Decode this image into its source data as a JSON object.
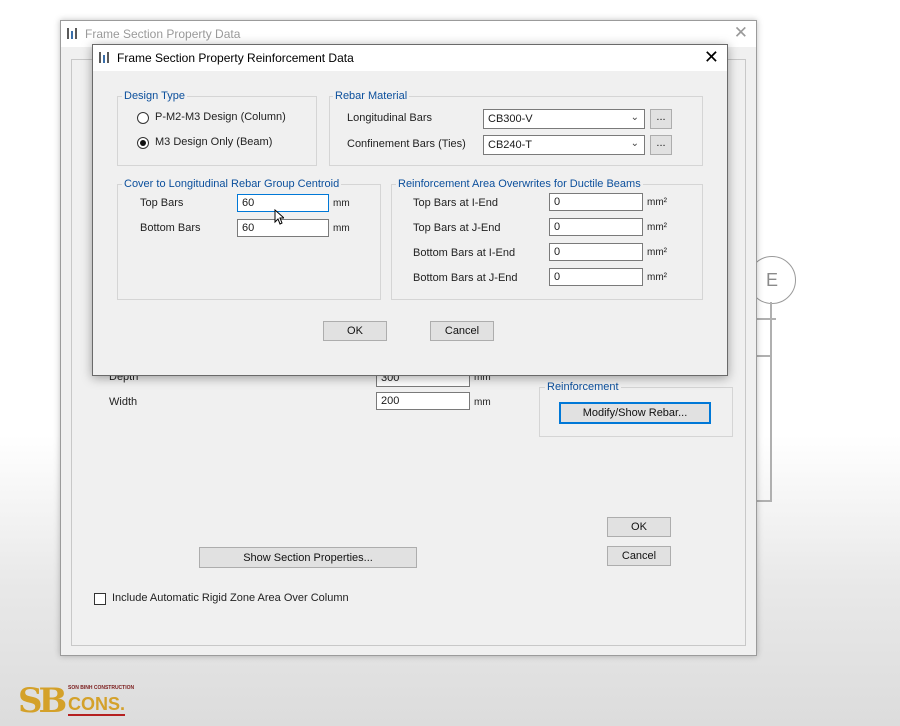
{
  "outer_window": {
    "title": "Frame Section Property Data",
    "close_glyph": "✕",
    "depth_label": "Depth",
    "depth_value": "300",
    "depth_unit": "mm",
    "width_label": "Width",
    "width_value": "200",
    "width_unit": "mm",
    "reinforcement_label": "Reinforcement",
    "modify_rebar_button": "Modify/Show Rebar...",
    "show_section_properties_button": "Show Section Properties...",
    "rigid_zone_checkbox_label": "Include Automatic Rigid Zone Area Over Column",
    "ok_button": "OK",
    "cancel_button": "Cancel"
  },
  "background_diagram": {
    "grid_bubble_label": "E"
  },
  "dialog": {
    "title": "Frame Section Property Reinforcement Data",
    "close_glyph": "✕",
    "design_type": {
      "legend": "Design Type",
      "options": [
        {
          "label": "P-M2-M3 Design  (Column)",
          "selected": false
        },
        {
          "label": "M3 Design Only  (Beam)",
          "selected": true
        }
      ]
    },
    "rebar_material": {
      "legend": "Rebar Material",
      "longitudinal_label": "Longitudinal Bars",
      "longitudinal_value": "CB300-V",
      "confinement_label": "Confinement Bars (Ties)",
      "confinement_value": "CB240-T",
      "ellipsis": "..."
    },
    "cover": {
      "legend": "Cover to Longitudinal Rebar Group Centroid",
      "top_label": "Top Bars",
      "top_value": "60",
      "bottom_label": "Bottom  Bars",
      "bottom_value": "60",
      "unit": "mm"
    },
    "overwrites": {
      "legend": "Reinforcement Area Overwrites for Ductile Beams",
      "rows": [
        {
          "label": "Top Bars at I-End",
          "value": "0",
          "unit": "mm²"
        },
        {
          "label": "Top Bars at J-End",
          "value": "0",
          "unit": "mm²"
        },
        {
          "label": "Bottom Bars at I-End",
          "value": "0",
          "unit": "mm²"
        },
        {
          "label": "Bottom Bars at J-End",
          "value": "0",
          "unit": "mm²"
        }
      ]
    },
    "ok_button": "OK",
    "cancel_button": "Cancel"
  },
  "logo": {
    "mark": "SB",
    "small_text": "SON BINH CONSTRUCTION",
    "brand": "CONS."
  },
  "colors": {
    "legend_blue": "#0b4f9c",
    "focus_blue": "#0078d7",
    "logo_gold": "#d4a12a",
    "logo_red": "#b52020"
  }
}
